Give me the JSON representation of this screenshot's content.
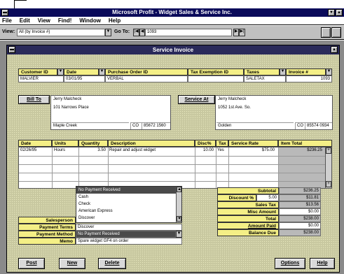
{
  "app": {
    "title": "Microsoft Profit - Widget Sales & Service Inc.",
    "menu": [
      "File",
      "Edit",
      "View",
      "Find!",
      "Window",
      "Help"
    ]
  },
  "toolbar": {
    "view_label": "View:",
    "view_value": "All (by Invoice #)",
    "goto_label": "Go To:",
    "goto_value": "1093"
  },
  "window": {
    "title": "Service Invoice"
  },
  "header_row": {
    "customer_id_label": "Customer ID",
    "customer_id": "MALVIER",
    "date_label": "Date",
    "date": "03/01/95",
    "po_label": "Purchase Order ID",
    "po": "VERBAL",
    "tax_exempt_label": "Tax Exemption ID",
    "tax_exempt": "",
    "taxes_label": "Taxes",
    "taxes": "SALETAX",
    "invoice_label": "Invoice #",
    "invoice": "1093"
  },
  "bill_to": {
    "label": "Bill To",
    "name": "Jerry Malcheck",
    "street": "101 Narrows Place",
    "city": "Maple Creek",
    "state": "CO",
    "zip": "85672 1560"
  },
  "service_at": {
    "label": "Service At",
    "name": "Jerry Malcheck",
    "street": "1052 1st Ave. So.",
    "city": "Golden",
    "state": "CO",
    "zip": "85574 0934"
  },
  "lines": {
    "headers": [
      "Date",
      "Units",
      "Quantity",
      "Description",
      "Disc%",
      "Tax",
      "Service Rate",
      "Item Total"
    ],
    "rows": [
      {
        "date": "02/26/95",
        "units": "Hours",
        "quantity": "3.50",
        "description": "Repair and adjust widget",
        "disc": "10.00",
        "tax": "Yes",
        "rate": "$75.00",
        "total": "$236.25"
      }
    ]
  },
  "payment_list": {
    "options": [
      "No Payment Received",
      "Cash",
      "Check",
      "American Express",
      "Discover"
    ],
    "highlighted": "No Payment Received"
  },
  "left_fields": {
    "salesperson_label": "Salesperson",
    "salesperson": "",
    "payment_terms_label": "Payment Terms",
    "payment_terms": "Discover",
    "payment_method_label": "Payment Method",
    "payment_method": "No Payment Received",
    "memo_label": "Memo",
    "memo": "Spare widget GF4 on order"
  },
  "totals": {
    "subtotal_label": "Subtotal",
    "subtotal": "$236.25",
    "discount_label": "Discount %",
    "discount_pct": "5.00",
    "discount_amt": "$11.81",
    "sales_tax_label": "Sales Tax",
    "sales_tax": "$13.56",
    "misc_label": "Misc Amount",
    "misc": "$0.00",
    "total_label": "Total",
    "total": "$238.00",
    "amount_paid_label": "Amount Paid",
    "amount_paid": "$0.00",
    "balance_label": "Balance Due",
    "balance": "$238.00"
  },
  "buttons": {
    "post": "Post",
    "new": "New",
    "delete": "Delete",
    "options": "Options",
    "help": "Help"
  },
  "colors": {
    "title_bar": "#000080",
    "label_yellow": "#f4ef86",
    "highlight": "#4a4a4a"
  }
}
